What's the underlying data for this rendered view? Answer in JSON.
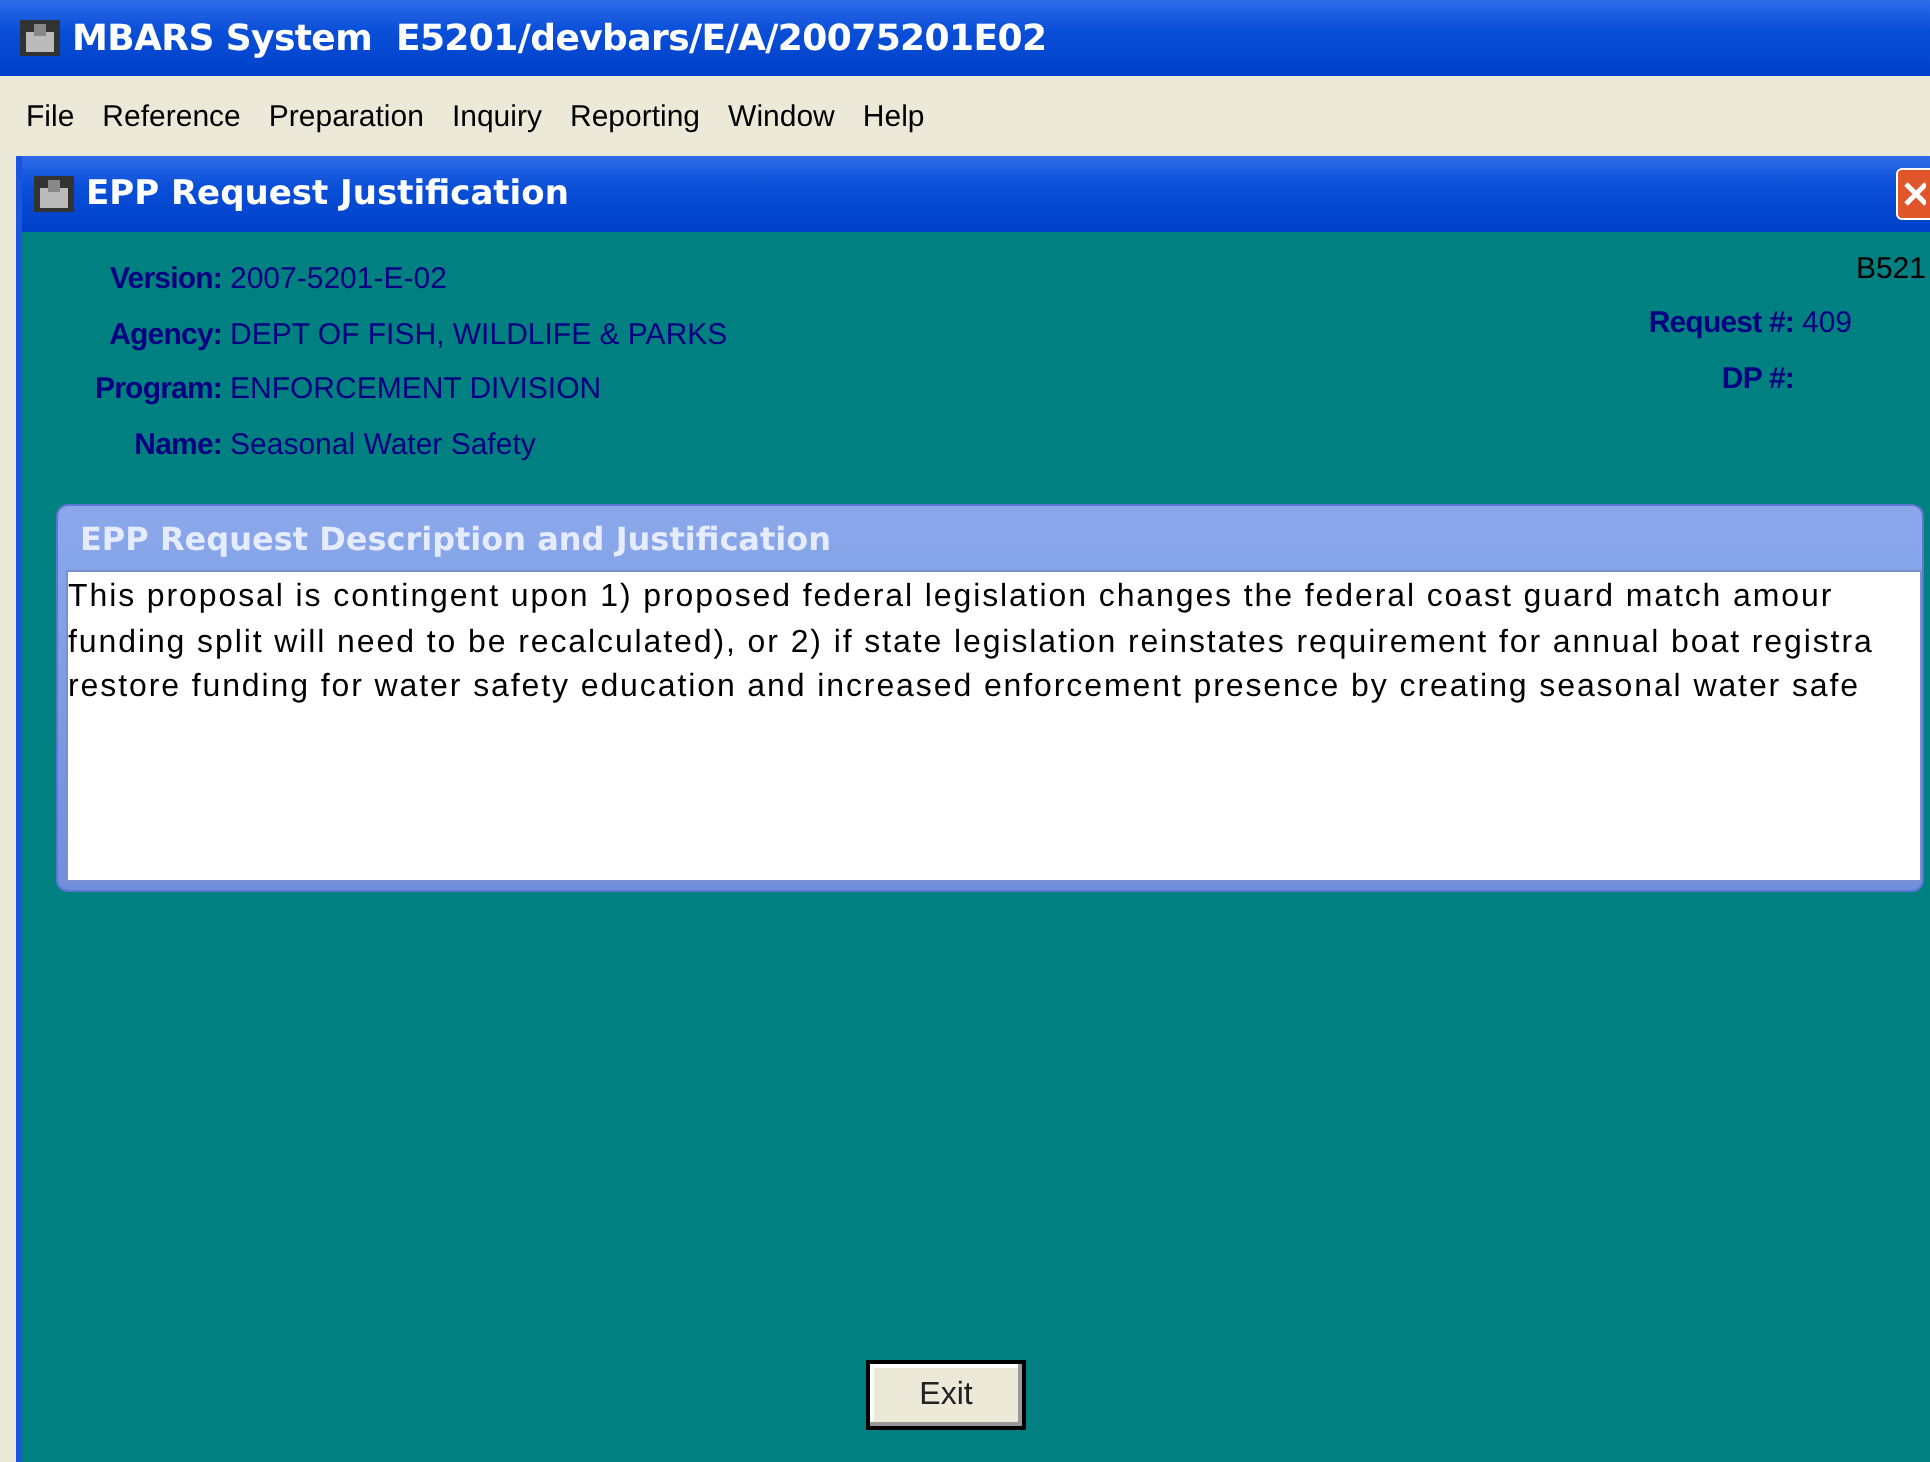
{
  "window": {
    "title": "MBARS System  E5201/devbars/E/A/20075201E02"
  },
  "menu": [
    "File",
    "Reference",
    "Preparation",
    "Inquiry",
    "Reporting",
    "Window",
    "Help"
  ],
  "child_window": {
    "title": "EPP Request Justification"
  },
  "code": "B521",
  "fields_left": [
    {
      "label": "Version:",
      "value": "2007-5201-E-02"
    },
    {
      "label": "Agency:",
      "value": "DEPT OF FISH, WILDLIFE & PARKS"
    },
    {
      "label": "Program:",
      "value": "ENFORCEMENT DIVISION"
    },
    {
      "label": "Name:",
      "value": "Seasonal Water Safety"
    }
  ],
  "fields_right": [
    {
      "label": "Request #:",
      "value": "409"
    },
    {
      "label": "DP #:"
    }
  ],
  "justification": {
    "title": "EPP Request Description and Justification",
    "lines": [
      "This proposal is contingent upon  1) proposed federal legislation changes the federal coast guard match amour",
      "funding split will need to be recalculated), or 2) if state legislation reinstates requirement for annual boat registra",
      "restore funding for water safety education and increased enforcement presence by creating seasonal water safe"
    ]
  },
  "buttons": [
    "Exit"
  ]
}
